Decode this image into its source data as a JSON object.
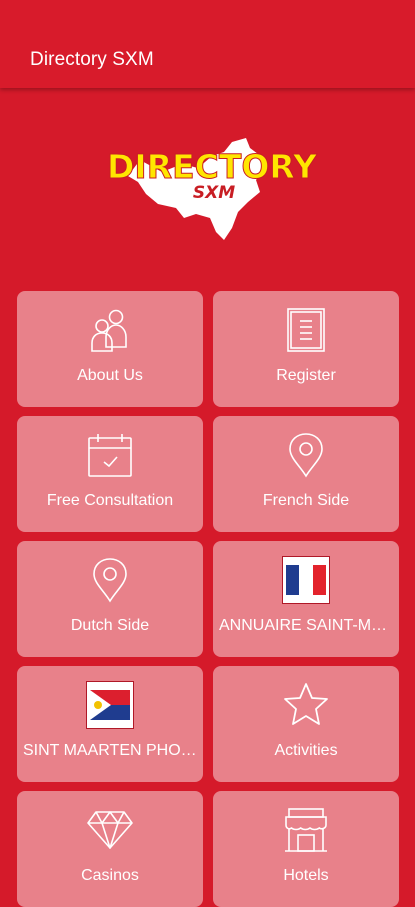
{
  "appbar": {
    "title": "Directory SXM"
  },
  "logo": {
    "line1": "DIRECTORY",
    "line2": "SXM"
  },
  "tiles": [
    {
      "label": "About Us",
      "icon": "users-icon"
    },
    {
      "label": "Register",
      "icon": "document-icon"
    },
    {
      "label": "Free Consultation",
      "icon": "calendar-check-icon"
    },
    {
      "label": "French Side",
      "icon": "map-pin-icon"
    },
    {
      "label": "Dutch Side",
      "icon": "map-pin-icon"
    },
    {
      "label": "ANNUAIRE SAINT-MARTIN",
      "icon": "french-flag-icon"
    },
    {
      "label": "SINT MAARTEN PHONE BOOK",
      "icon": "sint-maarten-flag-icon"
    },
    {
      "label": "Activities",
      "icon": "star-icon"
    },
    {
      "label": "Casinos",
      "icon": "diamond-icon"
    },
    {
      "label": "Hotels",
      "icon": "hotel-icon"
    }
  ],
  "colors": {
    "background": "#d51a2a",
    "logo_text": "#ffe600",
    "tile": "rgba(255,255,255,0.45)"
  }
}
